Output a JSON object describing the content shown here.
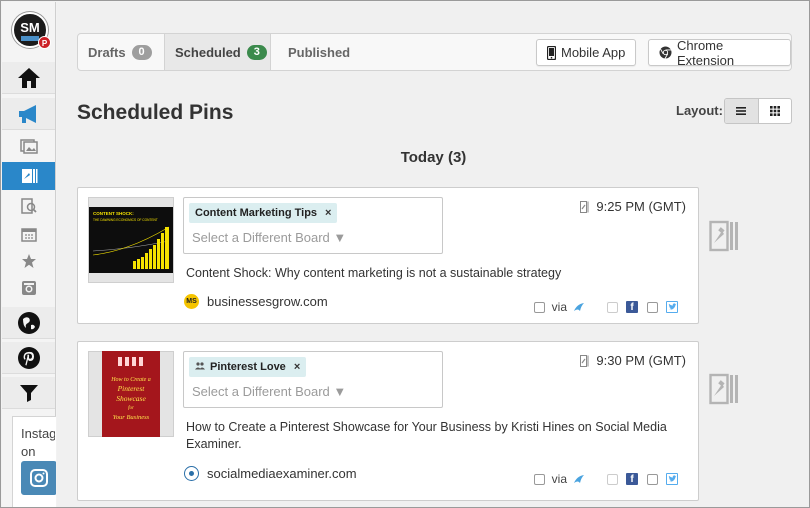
{
  "tabs": {
    "drafts": {
      "label": "Drafts",
      "count": "0"
    },
    "scheduled": {
      "label": "Scheduled",
      "count": "3"
    },
    "published": {
      "label": "Published"
    }
  },
  "toolbar": {
    "mobile_app_label": "Mobile App",
    "chrome_extension_label": "Chrome Extension"
  },
  "page": {
    "title": "Scheduled Pins",
    "layout_label": "Layout:",
    "day_heading": "Today (3)"
  },
  "sidebar": {
    "instagram_text": "Instagram on iOS"
  },
  "pins": [
    {
      "board": "Content Marketing Tips",
      "board_placeholder": "Select a Different Board ▼",
      "time": "9:25 PM (GMT)",
      "description": "Content Shock: Why content marketing is not a sustainable strategy",
      "source": "businessesgrow.com",
      "source_badge": "MS",
      "via_label": "via",
      "thumb_title": "CONTENT SHOCK:",
      "thumb_subtitle": "THE DAWNING ECONOMICS OF CONTENT"
    },
    {
      "board": "Pinterest Love",
      "board_placeholder": "Select a Different Board ▼",
      "time": "9:30 PM (GMT)",
      "description": "How to Create a Pinterest Showcase for Your Business by Kristi Hines on Social Media Examiner.",
      "source": "socialmediaexaminer.com",
      "via_label": "via",
      "thumb_lines": [
        "How to Create a",
        "Pinterest",
        "Showcase",
        "for",
        "Your Business"
      ]
    }
  ],
  "colors": {
    "active_nav": "#2a87c9",
    "scheduled_badge": "#3b8a4c",
    "chip_bg": "#dbeef0",
    "facebook": "#3b5998",
    "twitter": "#55acee"
  }
}
